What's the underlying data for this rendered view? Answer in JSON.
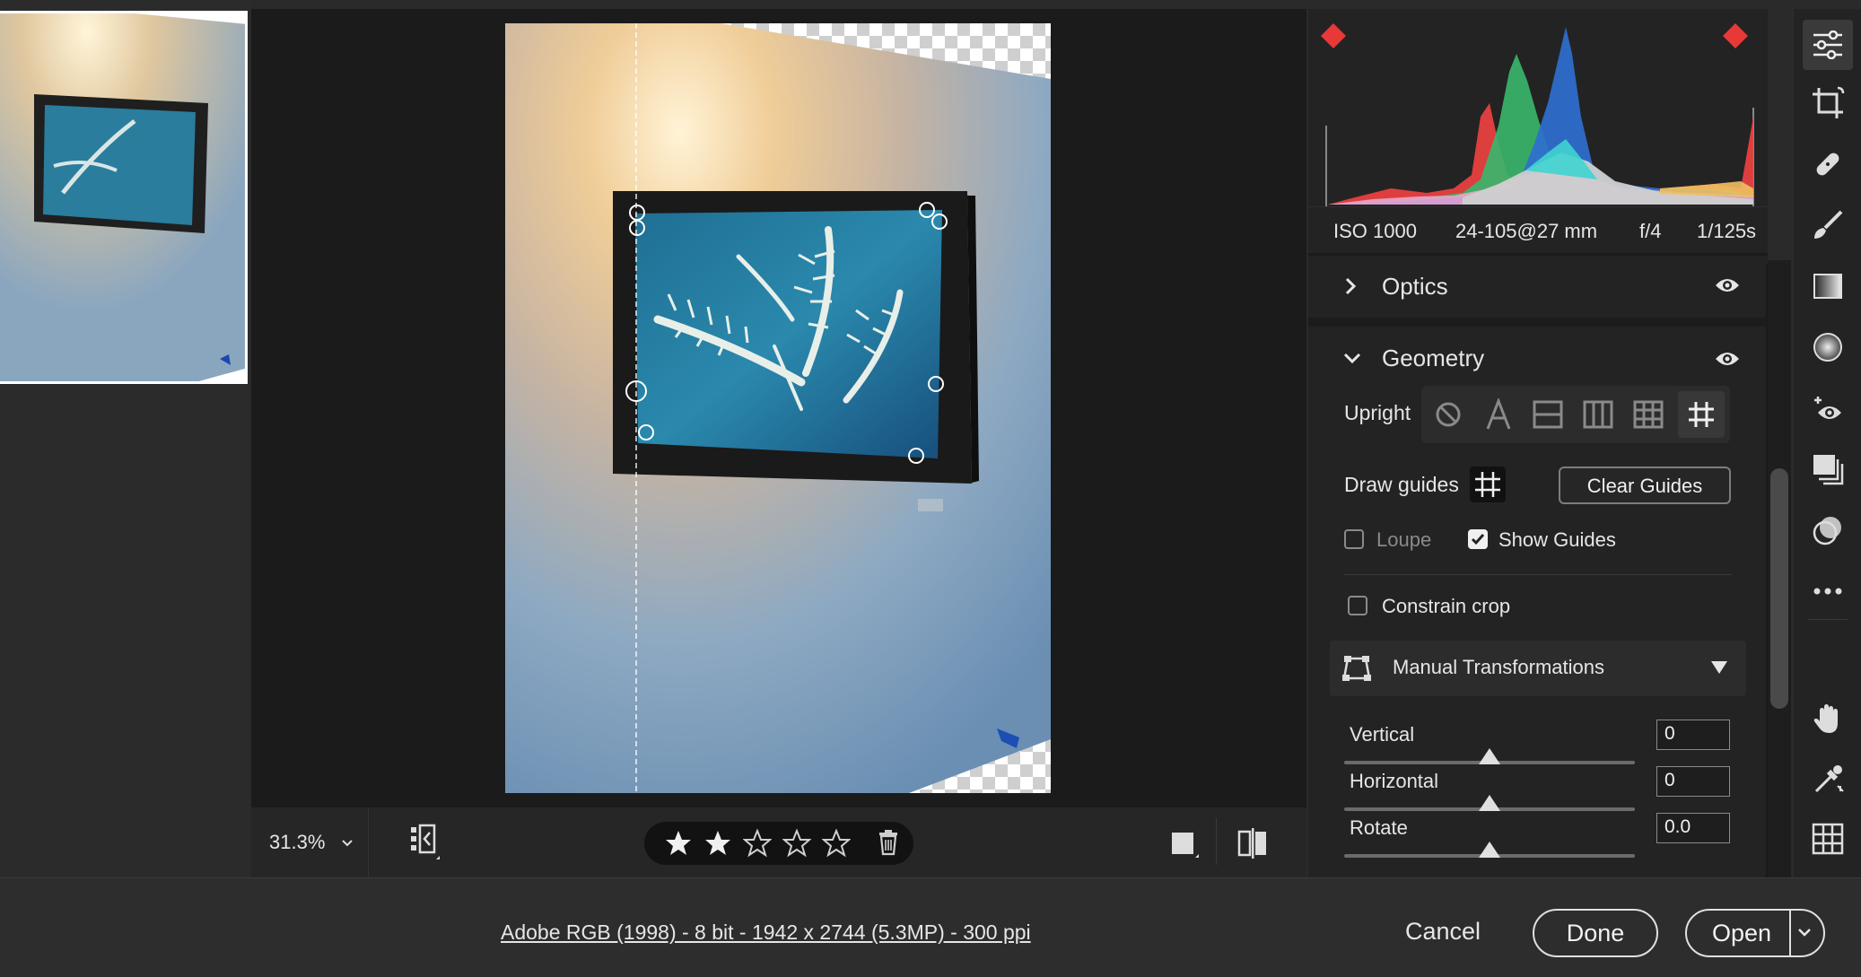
{
  "camera": {
    "iso": "ISO 1000",
    "lens": "24-105@27 mm",
    "aperture": "f/4",
    "shutter": "1/125s"
  },
  "sections": {
    "optics": "Optics",
    "geometry": "Geometry"
  },
  "geometry": {
    "upright_label": "Upright",
    "draw_guides_label": "Draw guides",
    "clear_guides_label": "Clear Guides",
    "loupe_label": "Loupe",
    "loupe_checked": false,
    "show_guides_label": "Show Guides",
    "show_guides_checked": true,
    "constrain_crop_label": "Constrain crop",
    "constrain_crop_checked": false,
    "manual_transformations_label": "Manual Transformations",
    "sliders": [
      {
        "label": "Vertical",
        "value": "0",
        "level": 0.5
      },
      {
        "label": "Horizontal",
        "value": "0",
        "level": 0.5
      },
      {
        "label": "Rotate",
        "value": "0.0",
        "level": 0.5
      }
    ]
  },
  "toolbar": {
    "zoom": "31.3%",
    "rating": 2,
    "max_rating": 5
  },
  "footer": {
    "file_info": "Adobe RGB (1998) - 8 bit - 1942 x 2744 (5.3MP) - 300 ppi",
    "cancel": "Cancel",
    "done": "Done",
    "open": "Open"
  },
  "colors": {
    "accent": "#e0e0e0",
    "clip_warning": "#e83838",
    "panel_bg": "#232323"
  }
}
